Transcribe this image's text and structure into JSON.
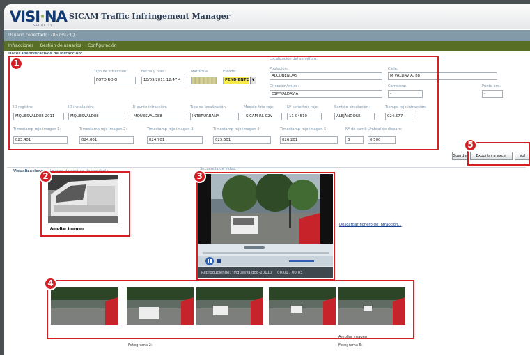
{
  "app": {
    "logo": "VISI NA",
    "logo_sub": "SECURITY",
    "title": "SICAM Traffic Infringement Manager",
    "user": "Usuario conectado: 78573973Q",
    "nav": [
      "Infracciones",
      "Gestión de usuarios",
      "Configuración"
    ]
  },
  "section1": {
    "title": "Datos identificativos de infracción:",
    "tipo_label": "Tipo de infracción:",
    "tipo_value": "FOTO ROJO",
    "fecha_label": "Fecha y hora:",
    "fecha_value": "10/09/2011 12:47:4",
    "matricula_label": "Matrícula:",
    "estado_label": "Estado:",
    "estado_value": "PENDIENTE",
    "loc_title": "Localización del semáforo:",
    "poblacion_label": "Población:",
    "poblacion_value": "ALCOBENDAS",
    "calle_label": "Calle:",
    "calle_value": "M VALDAVIA, 88",
    "direccion_label": "Dirección/cruce:",
    "direccion_value": "ESP/VALDAVIA",
    "carretera_label": "Carretera:",
    "carretera_value": "-",
    "pk_label": "Punto km.:",
    "pk_value": "-",
    "row2": [
      {
        "label": "ID registro:",
        "value": "MQUESVALD88-2011"
      },
      {
        "label": "ID instalación:",
        "value": "MQUESVALD88"
      },
      {
        "label": "ID punto infracción:",
        "value": "MQUESVALD88"
      },
      {
        "label": "Tipo de localización:",
        "value": "INTERURBANA"
      },
      {
        "label": "Modelo foto rojo:",
        "value": "SICAM-RL-02V"
      },
      {
        "label": "Nº serie foto rojo:",
        "value": "11-04510"
      },
      {
        "label": "Sentido circulación:",
        "value": "ALEJÁNDOSE"
      },
      {
        "label": "Tiempo rojo infracción:",
        "value": "024.577"
      }
    ],
    "row3": [
      {
        "label": "Timestamp rojo imagen 1:",
        "value": "023.401"
      },
      {
        "label": "Timestamp rojo imagen 2:",
        "value": "024.001"
      },
      {
        "label": "Timestamp rojo imagen 3:",
        "value": "024.701"
      },
      {
        "label": "Timestamp rojo imagen 4:",
        "value": "025.501"
      },
      {
        "label": "Timestamp rojo imagen 5:",
        "value": "026.201"
      },
      {
        "label": "Nº de carril:",
        "value": "3"
      },
      {
        "label": "Umbral de disparo:",
        "value": "0.500"
      }
    ]
  },
  "buttons": {
    "guardar": "Guardar",
    "exportar": "Exportar a excel",
    "volver": "Vol"
  },
  "visual": {
    "title": "Visualizaciones:",
    "img_label": "Imagen de captura de matrícula:",
    "ampliar": "Ampliar imagen",
    "video_label": "Secuencia de vídeo:",
    "video_status": "Reproduciendo: \"MquesValdd8-20110",
    "video_time": "00:01 / 00:03",
    "descargar": "Descargar fichero de infracción...",
    "fotograma2": "Fotograma 2:",
    "fotograma5": "Fotograma 5:",
    "ampliar2": "Ampliar imagen"
  },
  "callouts": [
    "1",
    "2",
    "3",
    "4",
    "5"
  ],
  "colors": {
    "accent_red": "#d42025",
    "nav_green": "#576e24",
    "user_bar": "#839aa9",
    "brand_blue": "#123b73"
  }
}
